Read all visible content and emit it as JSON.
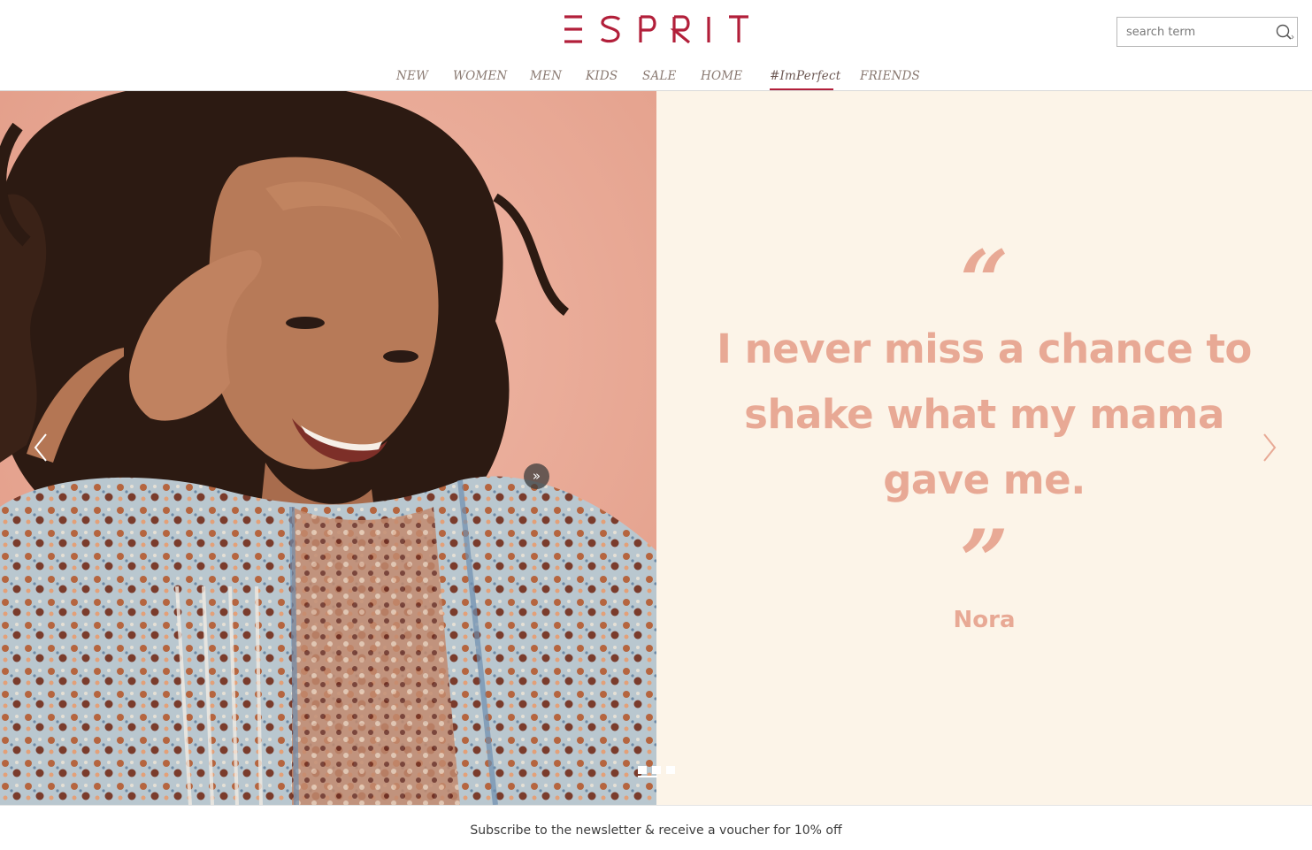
{
  "brand": {
    "name": "ESPRIT",
    "color": "#b21f3a"
  },
  "search": {
    "placeholder": "search term"
  },
  "nav": {
    "items": [
      {
        "label": "NEW"
      },
      {
        "label": "WOMEN"
      },
      {
        "label": "MEN"
      },
      {
        "label": "KIDS"
      },
      {
        "label": "SALE"
      },
      {
        "label": "HOME"
      },
      {
        "label": "#ImPerfect",
        "active": true
      },
      {
        "label": "FRIENDS"
      }
    ]
  },
  "hero": {
    "quote_open": "“",
    "quote_lines": [
      "I never miss a chance to",
      "shake what my mama",
      "gave me."
    ],
    "quote_close": "”",
    "author": "Nora",
    "more_button": "»",
    "slides": {
      "count": 3,
      "active": 1
    },
    "colors": {
      "quote": "#e8a995",
      "panel": "#fcf4e8",
      "photo_bg": "#e9a998"
    }
  },
  "newsletter": {
    "text": "Subscribe to the newsletter & receive a voucher for 10% off"
  }
}
